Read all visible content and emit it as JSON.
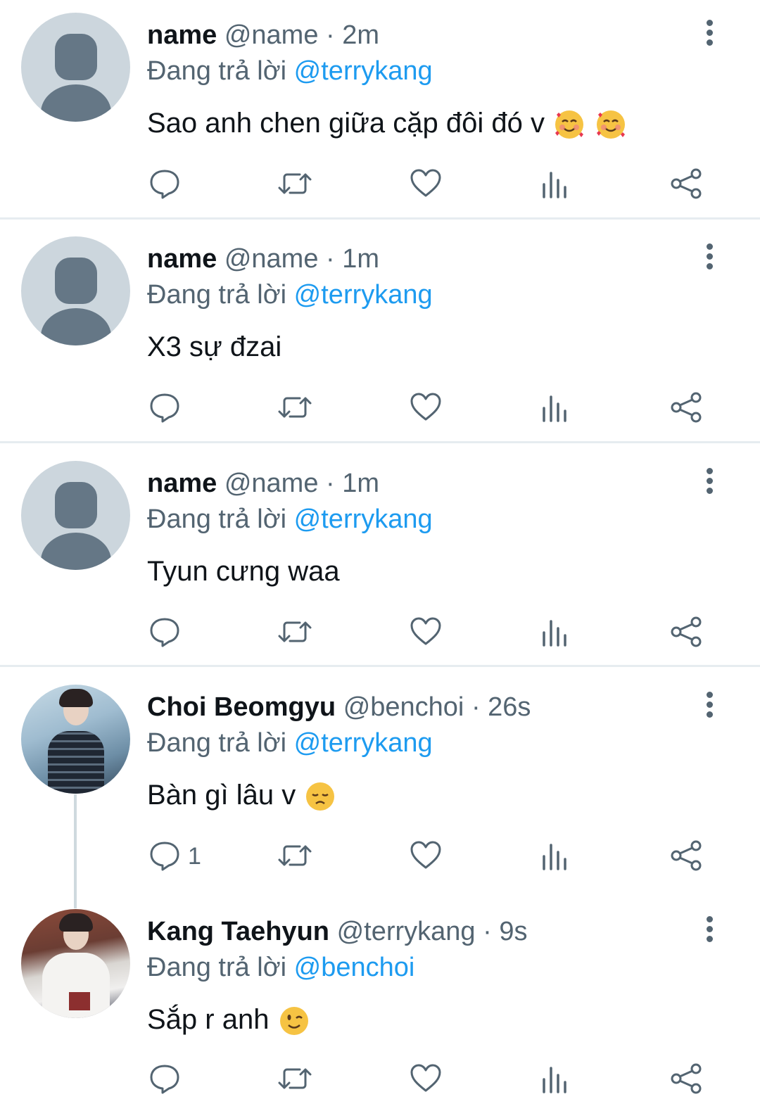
{
  "reply_prefix": "Đang trả lời",
  "tweets": [
    {
      "display_name": "name",
      "handle": "@name",
      "time": "· 2m",
      "reply_to": "@terrykang",
      "text": "Sao anh chen giữa cặp đôi đó v",
      "emojis": [
        "smiling-face-with-hearts",
        "smiling-face-with-hearts"
      ],
      "reply_count": "",
      "avatar": "default"
    },
    {
      "display_name": "name",
      "handle": "@name",
      "time": "· 1m",
      "reply_to": "@terrykang",
      "text": "X3 sự đzai",
      "emojis": [],
      "reply_count": "",
      "avatar": "default"
    },
    {
      "display_name": "name",
      "handle": "@name",
      "time": "· 1m",
      "reply_to": "@terrykang",
      "text": "Tyun cưng waa",
      "emojis": [],
      "reply_count": "",
      "avatar": "default"
    },
    {
      "display_name": "Choi Beomgyu",
      "handle": "@benchoi",
      "time": "· 26s",
      "reply_to": "@terrykang",
      "text": "Bàn gì lâu v",
      "emojis": [
        "disappointed-face"
      ],
      "reply_count": "1",
      "avatar": "photo"
    },
    {
      "display_name": "Kang Taehyun",
      "handle": "@terrykang",
      "time": "· 9s",
      "reply_to": "@benchoi",
      "text": "Sắp r anh",
      "emojis": [
        "winking-face"
      ],
      "reply_count": "",
      "avatar": "photo"
    }
  ],
  "action_icons": [
    "reply-icon",
    "retweet-icon",
    "like-icon",
    "views-icon",
    "share-icon"
  ],
  "colors": {
    "link": "#1d9bf0",
    "secondary_text": "#536471",
    "primary_text": "#0f1419",
    "divider": "#e6ecf0",
    "default_avatar_bg": "#ccd6dd",
    "default_avatar_fg": "#657786"
  }
}
